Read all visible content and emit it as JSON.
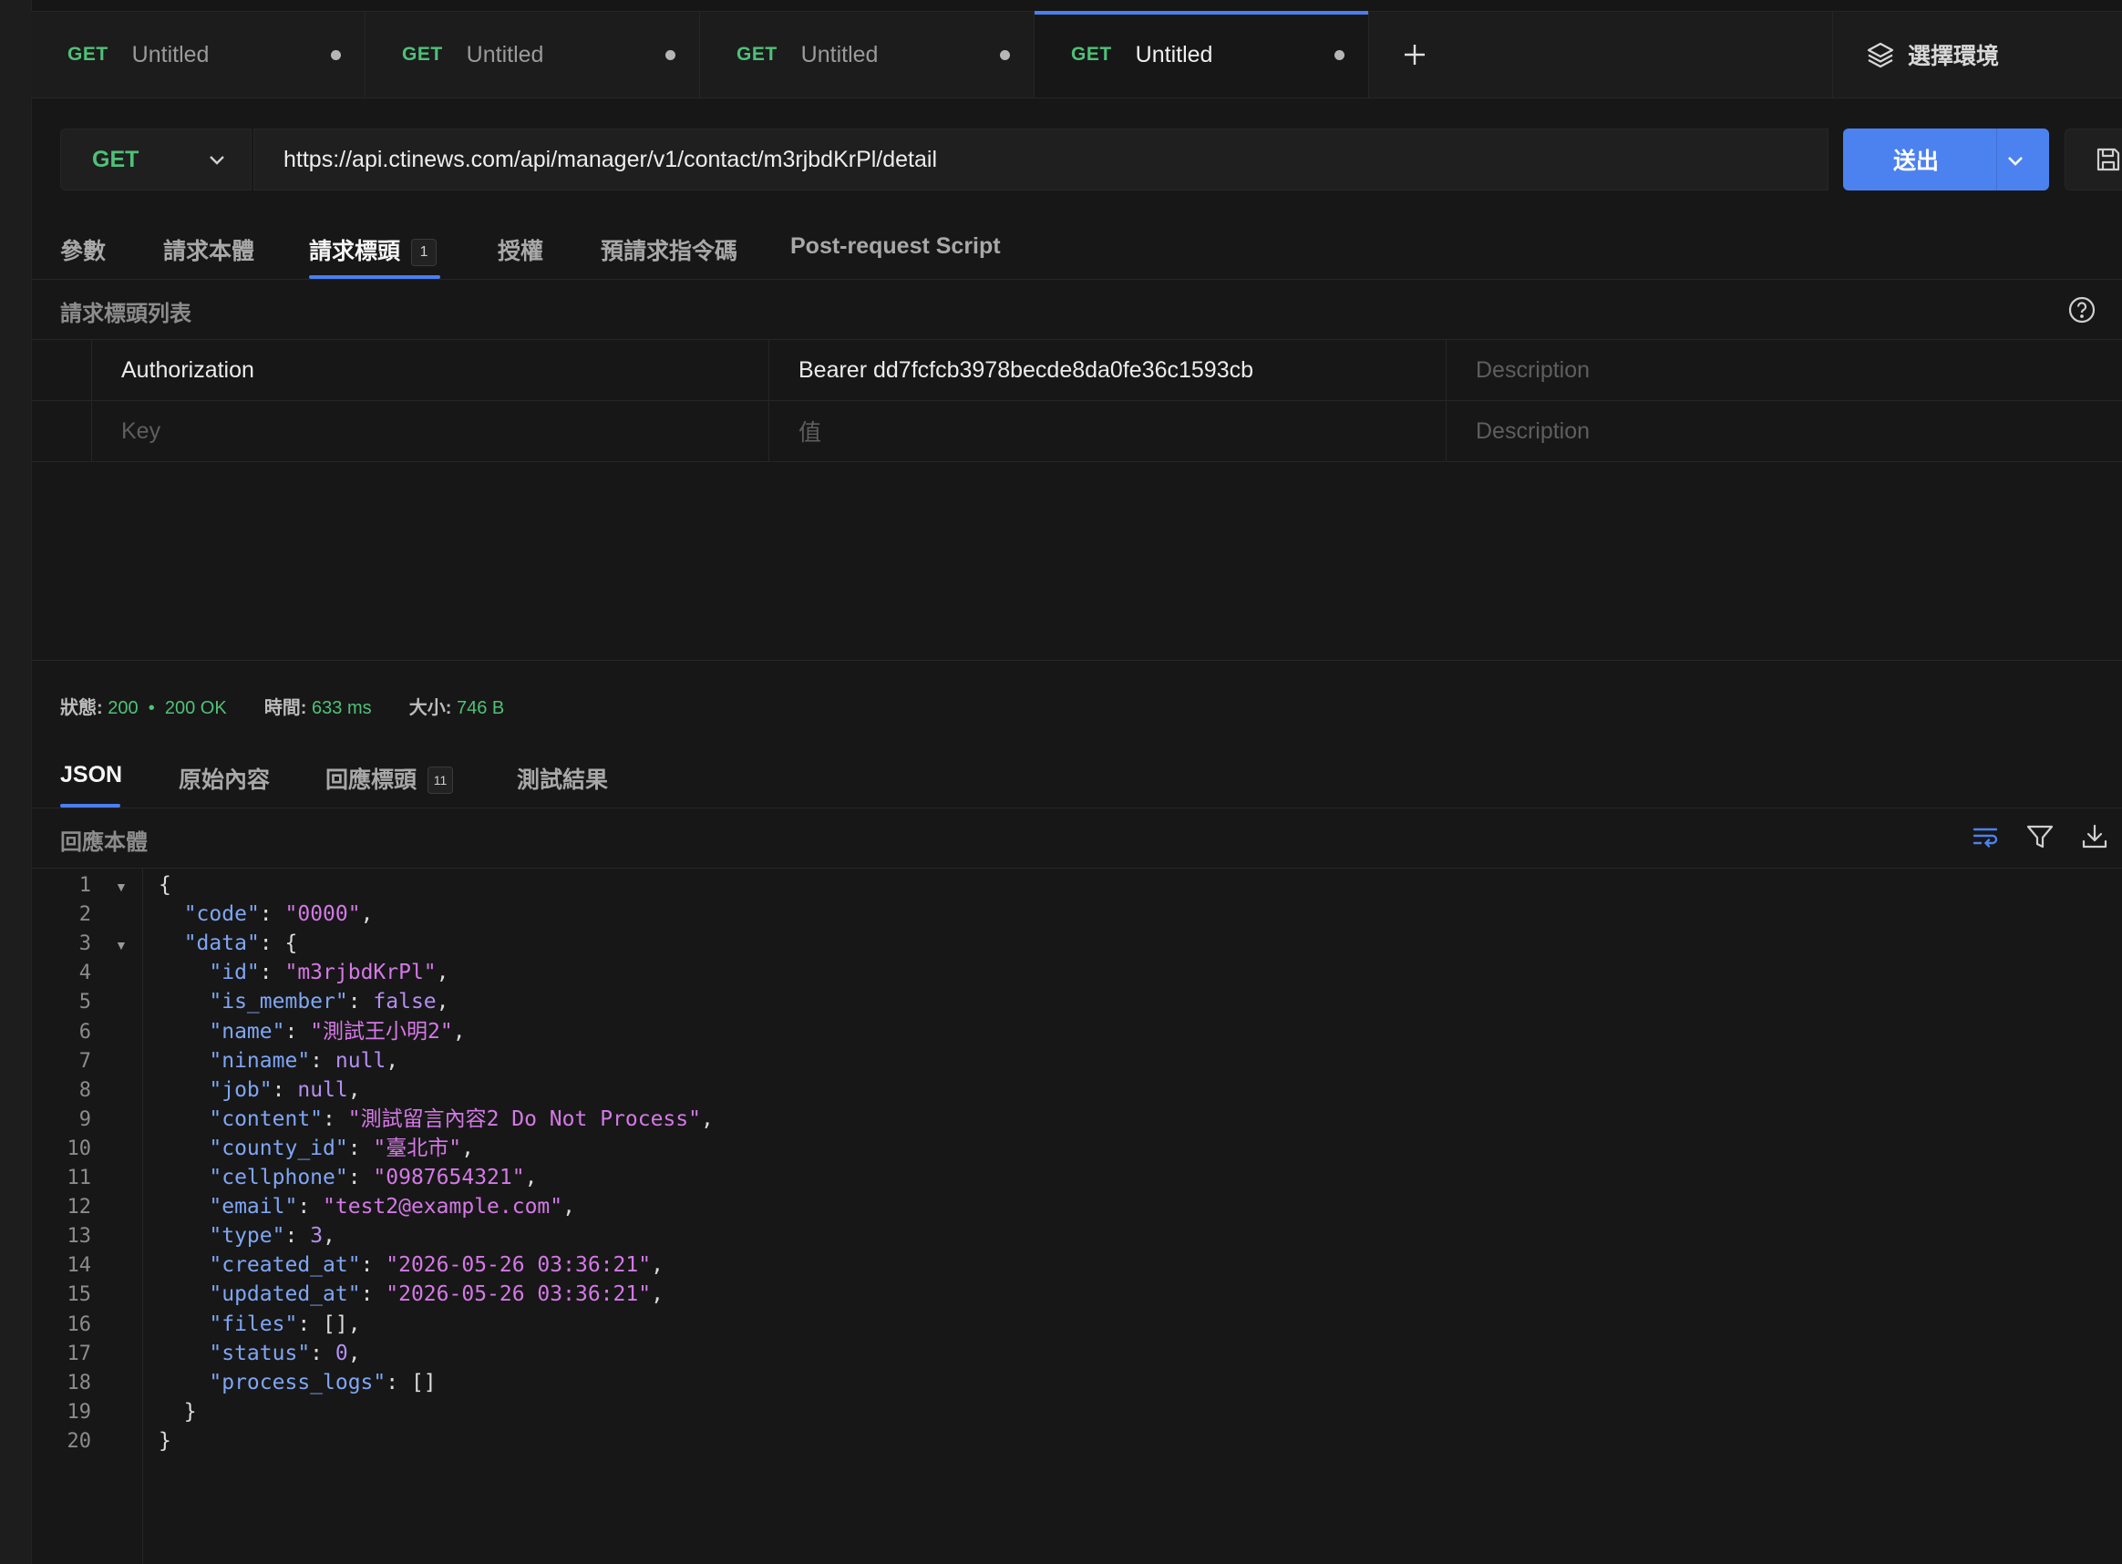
{
  "tabs": [
    {
      "method": "GET",
      "name": "Untitled"
    },
    {
      "method": "GET",
      "name": "Untitled"
    },
    {
      "method": "GET",
      "name": "Untitled"
    },
    {
      "method": "GET",
      "name": "Untitled"
    }
  ],
  "env_label": "選擇環境",
  "request": {
    "method": "GET",
    "url": "https://api.ctinews.com/api/manager/v1/contact/m3rjbdKrPl/detail",
    "send_label": "送出"
  },
  "req_tabs": [
    {
      "label": "參數"
    },
    {
      "label": "請求本體"
    },
    {
      "label": "請求標頭",
      "badge": "1"
    },
    {
      "label": "授權"
    },
    {
      "label": "預請求指令碼"
    },
    {
      "label": "Post-request Script"
    }
  ],
  "headers_section_label": "請求標頭列表",
  "headers": [
    {
      "key": "Authorization",
      "value": "Bearer dd7fcfcb3978becde8da0fe36c1593cb",
      "description_placeholder": "Description"
    }
  ],
  "new_header": {
    "key_placeholder": "Key",
    "value_placeholder": "值",
    "description_placeholder": "Description"
  },
  "status": {
    "status_label": "狀態:",
    "status_code": "200",
    "status_text": "200 OK",
    "time_label": "時間:",
    "time": "633 ms",
    "size_label": "大小:",
    "size": "746 B"
  },
  "resp_tabs": [
    {
      "label": "JSON"
    },
    {
      "label": "原始內容"
    },
    {
      "label": "回應標頭",
      "badge": "11"
    },
    {
      "label": "測試結果"
    }
  ],
  "response_body_label": "回應本體",
  "icons": {
    "env": "layers-icon",
    "method_dropdown": "chevron-down-icon",
    "send_dropdown": "chevron-down-icon",
    "save": "save-icon",
    "help": "help-circle-icon",
    "wrap": "wrap-lines-icon",
    "filter": "filter-icon",
    "download": "download-icon",
    "add_tab": "plus-icon"
  },
  "colors": {
    "accent": "#4b82f0",
    "method": "#4fc178",
    "json_key": "#7fa6f5",
    "json_string": "#d479e6",
    "json_literal": "#b48ef0"
  },
  "response_lines": [
    [
      [
        "p",
        "{"
      ]
    ],
    [
      [
        "p",
        "  "
      ],
      [
        "k",
        "\"code\""
      ],
      [
        "p",
        ": "
      ],
      [
        "s",
        "\"0000\""
      ],
      [
        "p",
        ","
      ]
    ],
    [
      [
        "p",
        "  "
      ],
      [
        "k",
        "\"data\""
      ],
      [
        "p",
        ": {"
      ]
    ],
    [
      [
        "p",
        "    "
      ],
      [
        "k",
        "\"id\""
      ],
      [
        "p",
        ": "
      ],
      [
        "s",
        "\"m3rjbdKrPl\""
      ],
      [
        "p",
        ","
      ]
    ],
    [
      [
        "p",
        "    "
      ],
      [
        "k",
        "\"is_member\""
      ],
      [
        "p",
        ": "
      ],
      [
        "n",
        "false"
      ],
      [
        "p",
        ","
      ]
    ],
    [
      [
        "p",
        "    "
      ],
      [
        "k",
        "\"name\""
      ],
      [
        "p",
        ": "
      ],
      [
        "s",
        "\"測試王小明2\""
      ],
      [
        "p",
        ","
      ]
    ],
    [
      [
        "p",
        "    "
      ],
      [
        "k",
        "\"niname\""
      ],
      [
        "p",
        ": "
      ],
      [
        "n",
        "null"
      ],
      [
        "p",
        ","
      ]
    ],
    [
      [
        "p",
        "    "
      ],
      [
        "k",
        "\"job\""
      ],
      [
        "p",
        ": "
      ],
      [
        "n",
        "null"
      ],
      [
        "p",
        ","
      ]
    ],
    [
      [
        "p",
        "    "
      ],
      [
        "k",
        "\"content\""
      ],
      [
        "p",
        ": "
      ],
      [
        "s",
        "\"測試留言內容2 Do Not Process\""
      ],
      [
        "p",
        ","
      ]
    ],
    [
      [
        "p",
        "    "
      ],
      [
        "k",
        "\"county_id\""
      ],
      [
        "p",
        ": "
      ],
      [
        "s",
        "\"臺北市\""
      ],
      [
        "p",
        ","
      ]
    ],
    [
      [
        "p",
        "    "
      ],
      [
        "k",
        "\"cellphone\""
      ],
      [
        "p",
        ": "
      ],
      [
        "s",
        "\"0987654321\""
      ],
      [
        "p",
        ","
      ]
    ],
    [
      [
        "p",
        "    "
      ],
      [
        "k",
        "\"email\""
      ],
      [
        "p",
        ": "
      ],
      [
        "s",
        "\"test2@example.com\""
      ],
      [
        "p",
        ","
      ]
    ],
    [
      [
        "p",
        "    "
      ],
      [
        "k",
        "\"type\""
      ],
      [
        "p",
        ": "
      ],
      [
        "n",
        "3"
      ],
      [
        "p",
        ","
      ]
    ],
    [
      [
        "p",
        "    "
      ],
      [
        "k",
        "\"created_at\""
      ],
      [
        "p",
        ": "
      ],
      [
        "s",
        "\"2026-05-26 03:36:21\""
      ],
      [
        "p",
        ","
      ]
    ],
    [
      [
        "p",
        "    "
      ],
      [
        "k",
        "\"updated_at\""
      ],
      [
        "p",
        ": "
      ],
      [
        "s",
        "\"2026-05-26 03:36:21\""
      ],
      [
        "p",
        ","
      ]
    ],
    [
      [
        "p",
        "    "
      ],
      [
        "k",
        "\"files\""
      ],
      [
        "p",
        ": [],"
      ]
    ],
    [
      [
        "p",
        "    "
      ],
      [
        "k",
        "\"status\""
      ],
      [
        "p",
        ": "
      ],
      [
        "n",
        "0"
      ],
      [
        "p",
        ","
      ]
    ],
    [
      [
        "p",
        "    "
      ],
      [
        "k",
        "\"process_logs\""
      ],
      [
        "p",
        ": []"
      ]
    ],
    [
      [
        "p",
        "  }"
      ]
    ],
    [
      [
        "p",
        "}"
      ]
    ]
  ]
}
